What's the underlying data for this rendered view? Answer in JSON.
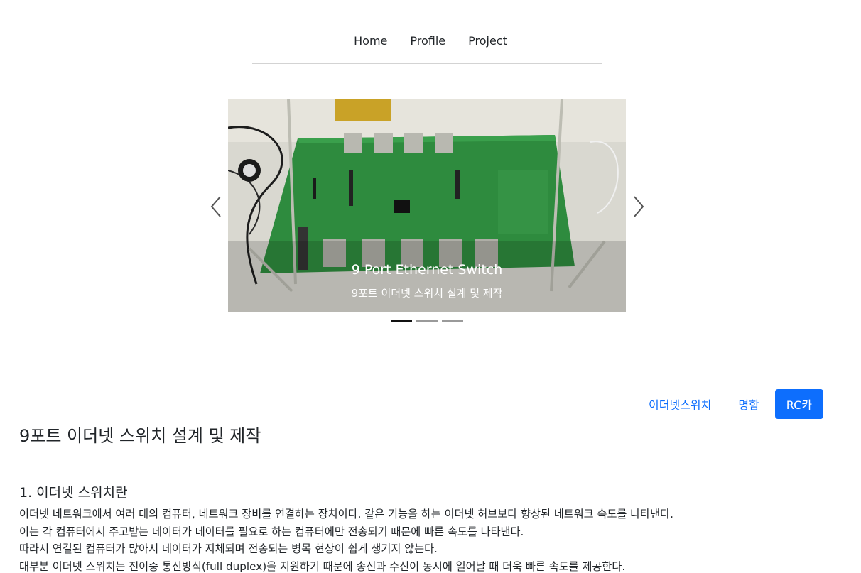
{
  "nav": {
    "items": [
      "Home",
      "Profile",
      "Project"
    ]
  },
  "carousel": {
    "caption_title": "9 Port Ethernet Switch",
    "caption_subtitle": "9포트 이더넷 스위치 설계 및 제작",
    "slide_count": 3,
    "active_index": 0
  },
  "tabs": {
    "items": [
      "이더넷스위치",
      "명함",
      "RC카"
    ],
    "active_index": 2
  },
  "content": {
    "title": "9포트 이더넷 스위치 설계 및 제작",
    "section_title": "1. 이더넷 스위치란",
    "paragraphs": [
      "이더넷 네트워크에서 여러 대의 컴퓨터, 네트워크 장비를 연결하는 장치이다. 같은 기능을 하는 이더넷 허브보다 향상된 네트워크 속도를 나타낸다.",
      "이는 각 컴퓨터에서 주고받는 데이터가 데이터를 필요로 하는 컴퓨터에만 전송되기 때문에 빠른 속도를 나타낸다.",
      "따라서 연결된 컴퓨터가 많아서 데이터가 지체되며 전송되는 병목 현상이 쉽게 생기지 않는다.",
      "대부분 이더넷 스위치는 전이중 통신방식(full duplex)을 지원하기 때문에 송신과 수신이 동시에 일어날 때 더욱 빠른 속도를 제공한다."
    ]
  },
  "colors": {
    "accent": "#0d6efd",
    "pcb_green": "#2e8b3e"
  }
}
